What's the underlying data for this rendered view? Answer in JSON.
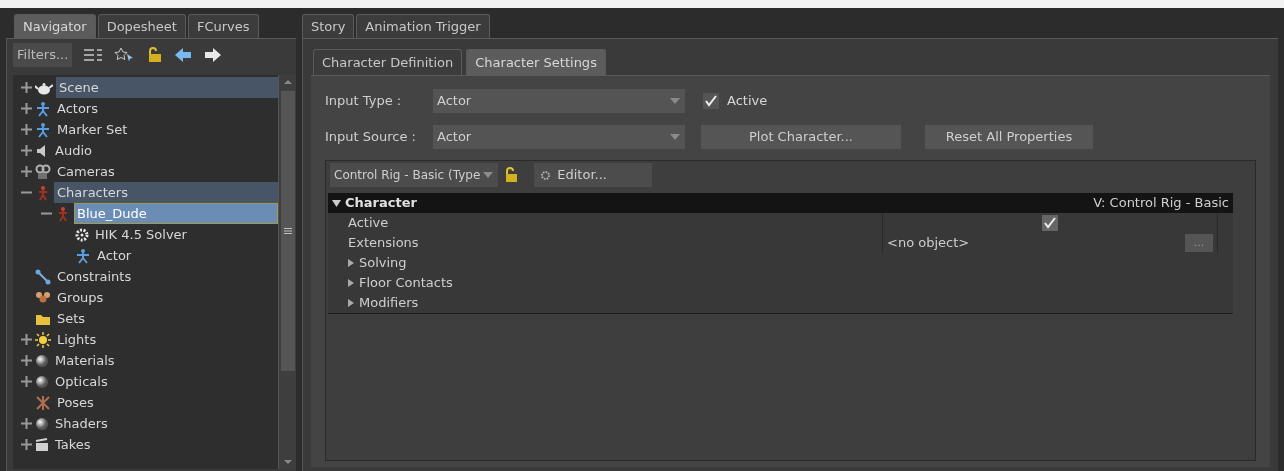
{
  "top_tabs": [
    {
      "label": "Navigator",
      "selected": true
    },
    {
      "label": "Dopesheet",
      "selected": false
    },
    {
      "label": "FCurves",
      "selected": false
    }
  ],
  "right_tabs": [
    {
      "label": "Story",
      "selected": false
    },
    {
      "label": "Animation Trigger",
      "selected": false
    }
  ],
  "navigator": {
    "filters_button": "Filters...",
    "tree": [
      {
        "label": "Scene",
        "kind": "collapsed",
        "highlighted": true,
        "selected": false
      },
      {
        "label": "Actors",
        "kind": "collapsed",
        "highlighted": false,
        "selected": false
      },
      {
        "label": "Marker Set",
        "kind": "collapsed",
        "highlighted": false,
        "selected": false
      },
      {
        "label": "Audio",
        "kind": "collapsed",
        "highlighted": false,
        "selected": false
      },
      {
        "label": "Cameras",
        "kind": "collapsed",
        "highlighted": false,
        "selected": false
      },
      {
        "label": "Characters",
        "kind": "expanded",
        "highlighted": true,
        "selected": false,
        "children": [
          {
            "label": "Blue_Dude",
            "kind": "expanded",
            "highlighted": true,
            "selected": true,
            "children": [
              {
                "label": "HIK 4.5 Solver",
                "kind": "leaf",
                "highlighted": false,
                "selected": false
              },
              {
                "label": "Actor",
                "kind": "leaf",
                "highlighted": false,
                "selected": false
              }
            ]
          }
        ]
      },
      {
        "label": "Constraints",
        "kind": "leaf",
        "highlighted": false,
        "selected": false
      },
      {
        "label": "Groups",
        "kind": "leaf",
        "highlighted": false,
        "selected": false
      },
      {
        "label": "Sets",
        "kind": "leaf",
        "highlighted": false,
        "selected": false
      },
      {
        "label": "Lights",
        "kind": "collapsed",
        "highlighted": false,
        "selected": false
      },
      {
        "label": "Materials",
        "kind": "collapsed",
        "highlighted": false,
        "selected": false
      },
      {
        "label": "Opticals",
        "kind": "collapsed",
        "highlighted": false,
        "selected": false
      },
      {
        "label": "Poses",
        "kind": "leaf",
        "highlighted": false,
        "selected": false
      },
      {
        "label": "Shaders",
        "kind": "collapsed",
        "highlighted": false,
        "selected": false
      },
      {
        "label": "Takes",
        "kind": "collapsed",
        "highlighted": false,
        "selected": false
      }
    ]
  },
  "character_tabs": [
    {
      "label": "Character Definition",
      "selected": false
    },
    {
      "label": "Character Settings",
      "selected": true
    }
  ],
  "input_type": {
    "label": "Input Type :",
    "value": "Actor"
  },
  "active_checkbox": {
    "label": "Active",
    "checked": true
  },
  "input_source": {
    "label": "Input Source :",
    "value": "Actor"
  },
  "plot_button": "Plot Character...",
  "reset_button": "Reset All Properties",
  "rig_dropdown": "Control Rig - Basic (Type",
  "editor_button": "Editor...",
  "properties": {
    "section": "Character",
    "expanded": true,
    "version": "V: Control Rig - Basic",
    "rows": [
      {
        "kind": "checkbox",
        "label": "Active",
        "checked": true
      },
      {
        "kind": "object",
        "label": "Extensions",
        "value": "<no object>",
        "button": "..."
      },
      {
        "kind": "group",
        "label": "Solving",
        "expanded": false
      },
      {
        "kind": "group",
        "label": "Floor Contacts",
        "expanded": false
      },
      {
        "kind": "group",
        "label": "Modifiers",
        "expanded": false
      }
    ]
  }
}
